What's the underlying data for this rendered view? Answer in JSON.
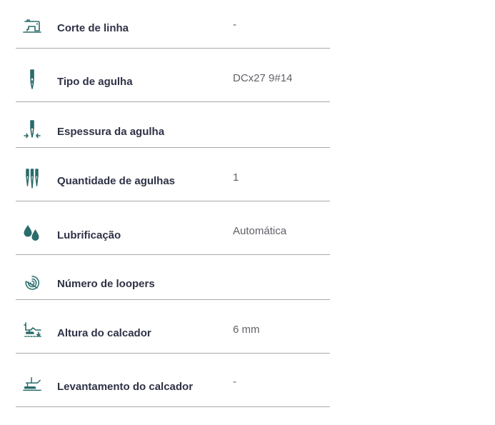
{
  "specs": [
    {
      "icon": "sewing-machine-icon",
      "label": "Corte de linha",
      "value": "-"
    },
    {
      "icon": "needle-icon",
      "label": "Tipo de agulha",
      "value": "DCx27 9#14"
    },
    {
      "icon": "needle-thickness-icon",
      "label": "Espessura da agulha",
      "value": ""
    },
    {
      "icon": "multiple-needles-icon",
      "label": "Quantidade de agulhas",
      "value": "1"
    },
    {
      "icon": "oil-drops-icon",
      "label": "Lubrificação",
      "value": "Automática"
    },
    {
      "icon": "looper-spiral-icon",
      "label": "Número de loopers",
      "value": ""
    },
    {
      "icon": "presser-foot-height-icon",
      "label": "Altura do calcador",
      "value": "6 mm"
    },
    {
      "icon": "presser-foot-lift-icon",
      "label": "Levantamento do calcador",
      "value": "-"
    }
  ],
  "colors": {
    "icon": "#2a6b6b",
    "label": "#2e3245",
    "value": "#5f6168",
    "divider": "#a9a9a9"
  }
}
